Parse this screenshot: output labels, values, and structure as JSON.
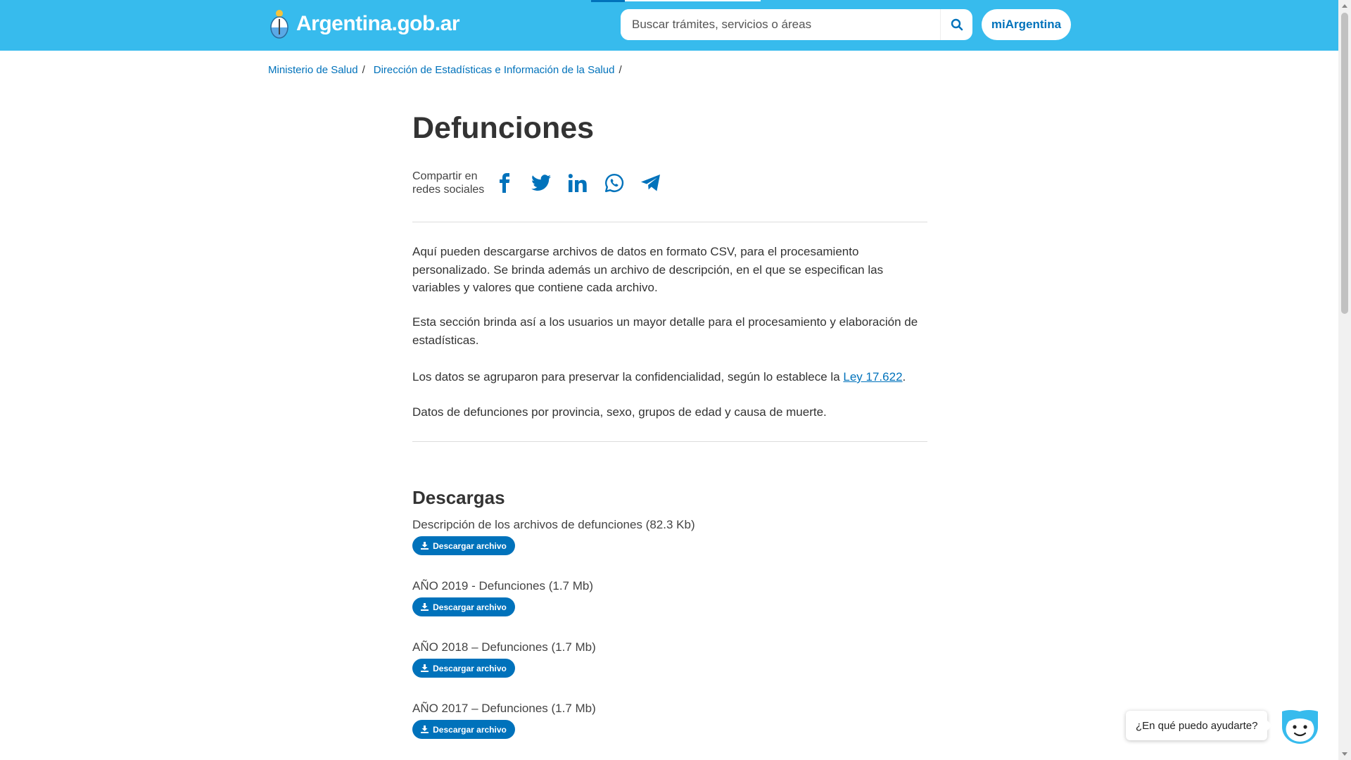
{
  "header": {
    "brand": "Argentina.gob.ar",
    "search_placeholder": "Buscar trámites, servicios o áreas",
    "account_button": "miArgentina",
    "bg_color": "#37bbed"
  },
  "breadcrumb": [
    {
      "label": "Ministerio de Salud"
    },
    {
      "label": "Dirección de Estadísticas e Información de la Salud"
    }
  ],
  "page": {
    "title": "Defunciones",
    "share_label_line1": "Compartir en",
    "share_label_line2": "redes sociales",
    "share_icons": [
      "facebook-icon",
      "twitter-icon",
      "linkedin-icon",
      "whatsapp-icon",
      "telegram-icon"
    ],
    "paragraphs": {
      "p1": "Aquí pueden descargarse archivos de datos en formato CSV, para el procesamiento personalizado. Se brinda además un archivo de descripción, en el que se especifican las variables y valores que contiene cada archivo.",
      "p2": "Esta sección brinda así a los usuarios un mayor detalle para el procesamiento y elaboración de estadísticas.",
      "p3_before": "Los datos se agruparon para preservar la confidencialidad, según lo establece la ",
      "p3_link": "Ley 17.622",
      "p3_after": ".",
      "p4": "Datos de defunciones por provincia, sexo, grupos de edad y causa de muerte."
    },
    "downloads_heading": "Descargas",
    "downloads": [
      {
        "name": "Descripción de los archivos de defunciones (82.3 Kb)",
        "button": "Descargar archivo"
      },
      {
        "name": "AÑO 2019 - Defunciones (1.7 Mb)",
        "button": "Descargar archivo"
      },
      {
        "name": "AÑO 2018 – Defunciones (1.7 Mb)",
        "button": "Descargar archivo"
      },
      {
        "name": "AÑO 2017 – Defunciones (1.7 Mb)",
        "button": "Descargar archivo"
      }
    ],
    "accent_color": "#0072bb"
  },
  "chat": {
    "prompt": "¿En qué puedo ayudarte?"
  }
}
